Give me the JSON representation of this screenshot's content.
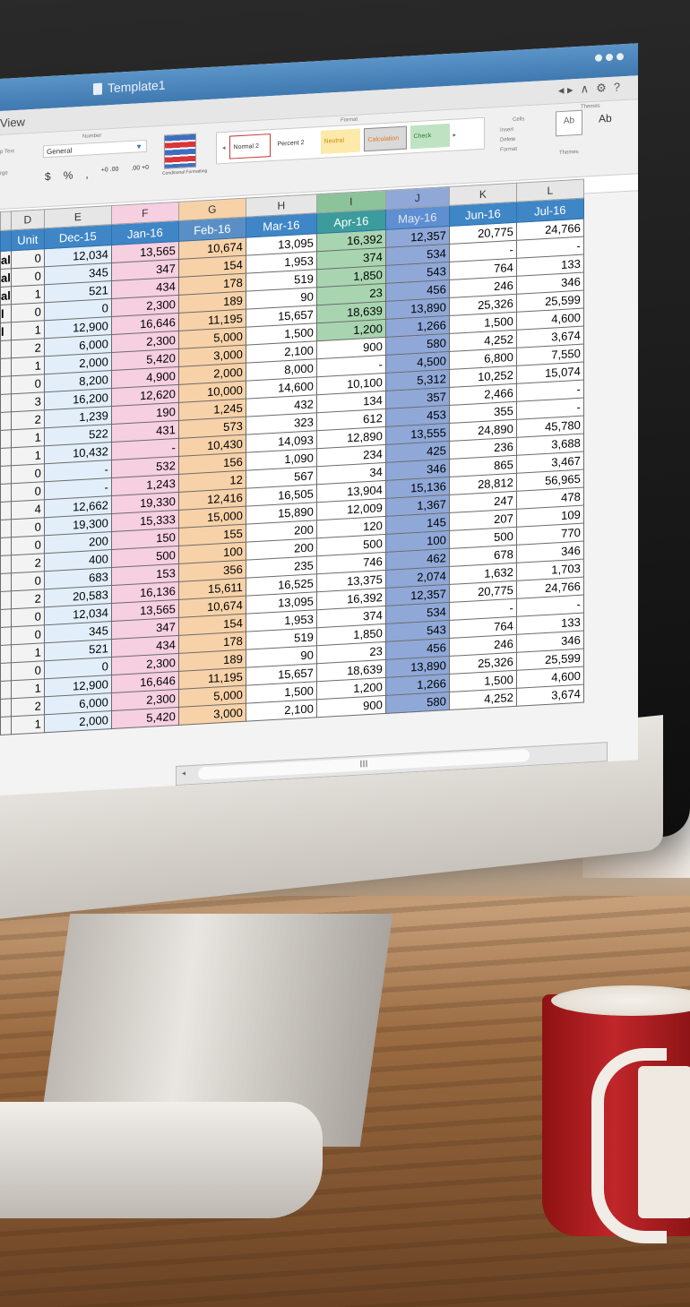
{
  "window": {
    "title": "Template1"
  },
  "menu": {
    "view_label": "View"
  },
  "ribbon": {
    "number_group_label": "Number",
    "format_group_label": "Format",
    "cells_group_label": "Cells",
    "themes_group_label": "Themes",
    "wrap_text_label": "p Text",
    "merge_label": "rge",
    "number_format_value": "General",
    "currency_label": "$",
    "percent_label": "%",
    "comma_label": ",",
    "conditional_formatting_label": "Conditional Formatting",
    "cell_styles": [
      "Normal 2",
      "Percent 2",
      "Neutral",
      "Calculation",
      "Check"
    ],
    "insert_label": "Insert",
    "delete_label": "Delete",
    "format_label": "Format",
    "themes_label": "Themes",
    "themes_icon_text": "Ab",
    "themes_font_text": "Ab"
  },
  "sheet": {
    "column_letters": [
      "D",
      "E",
      "F",
      "G",
      "H",
      "I",
      "J",
      "K",
      "L"
    ],
    "header_row": [
      "Unit",
      "Dec-15",
      "Jan-16",
      "Feb-16",
      "Mar-16",
      "Apr-16",
      "May-16",
      "Jun-16",
      "Jul-16"
    ],
    "rows": [
      [
        "0",
        "12,034",
        "13,565",
        "10,674",
        "13,095",
        "16,392",
        "12,357",
        "20,775",
        "24,766"
      ],
      [
        "0",
        "345",
        "347",
        "154",
        "1,953",
        "374",
        "534",
        "-",
        "-"
      ],
      [
        "1",
        "521",
        "434",
        "178",
        "519",
        "1,850",
        "543",
        "764",
        "133"
      ],
      [
        "0",
        "0",
        "2,300",
        "189",
        "90",
        "23",
        "456",
        "246",
        "346"
      ],
      [
        "1",
        "12,900",
        "16,646",
        "11,195",
        "15,657",
        "18,639",
        "13,890",
        "25,326",
        "25,599"
      ],
      [
        "2",
        "6,000",
        "2,300",
        "5,000",
        "1,500",
        "1,200",
        "1,266",
        "1,500",
        "4,600"
      ],
      [
        "1",
        "2,000",
        "5,420",
        "3,000",
        "2,100",
        "900",
        "580",
        "4,252",
        "3,674"
      ],
      [
        "0",
        "8,200",
        "4,900",
        "2,000",
        "8,000",
        "-",
        "4,500",
        "6,800",
        "7,550"
      ],
      [
        "3",
        "16,200",
        "12,620",
        "10,000",
        "14,600",
        "10,100",
        "5,312",
        "10,252",
        "15,074"
      ],
      [
        "2",
        "1,239",
        "190",
        "1,245",
        "432",
        "134",
        "357",
        "2,466",
        "-"
      ],
      [
        "1",
        "522",
        "431",
        "573",
        "323",
        "612",
        "453",
        "355",
        "-"
      ],
      [
        "1",
        "10,432",
        "-",
        "10,430",
        "14,093",
        "12,890",
        "13,555",
        "24,890",
        "45,780"
      ],
      [
        "0",
        "-",
        "532",
        "156",
        "1,090",
        "234",
        "425",
        "236",
        "3,688"
      ],
      [
        "0",
        "-",
        "1,243",
        "12",
        "567",
        "34",
        "346",
        "865",
        "3,467"
      ],
      [
        "4",
        "12,662",
        "19,330",
        "12,416",
        "16,505",
        "13,904",
        "15,136",
        "28,812",
        "56,965"
      ],
      [
        "0",
        "19,300",
        "15,333",
        "15,000",
        "15,890",
        "12,009",
        "1,367",
        "247",
        "478"
      ],
      [
        "0",
        "200",
        "150",
        "155",
        "200",
        "120",
        "145",
        "207",
        "109"
      ],
      [
        "2",
        "400",
        "500",
        "100",
        "200",
        "500",
        "100",
        "500",
        "770"
      ],
      [
        "0",
        "683",
        "153",
        "356",
        "235",
        "746",
        "462",
        "678",
        "346"
      ],
      [
        "2",
        "20,583",
        "16,136",
        "15,611",
        "16,525",
        "13,375",
        "2,074",
        "1,632",
        "1,703"
      ],
      [
        "0",
        "12,034",
        "13,565",
        "10,674",
        "13,095",
        "16,392",
        "12,357",
        "20,775",
        "24,766"
      ],
      [
        "0",
        "345",
        "347",
        "154",
        "1,953",
        "374",
        "534",
        "-",
        "-"
      ],
      [
        "1",
        "521",
        "434",
        "178",
        "519",
        "1,850",
        "543",
        "764",
        "133"
      ],
      [
        "0",
        "0",
        "2,300",
        "189",
        "90",
        "23",
        "456",
        "246",
        "346"
      ],
      [
        "1",
        "12,900",
        "16,646",
        "11,195",
        "15,657",
        "18,639",
        "13,890",
        "25,326",
        "25,599"
      ],
      [
        "2",
        "6,000",
        "2,300",
        "5,000",
        "1,500",
        "1,200",
        "1,266",
        "1,500",
        "4,600"
      ],
      [
        "1",
        "2,000",
        "5,420",
        "3,000",
        "2,100",
        "900",
        "580",
        "4,252",
        "3,674"
      ]
    ],
    "stub_labels": [
      "al",
      "al",
      "al",
      "l",
      "l",
      "",
      "",
      "",
      "",
      "",
      "",
      "",
      "",
      "",
      "",
      "",
      "",
      "",
      "",
      "",
      "",
      "",
      "",
      "",
      "",
      "",
      ""
    ],
    "scroll_thumb_text": "III"
  },
  "colors": {
    "header_blue": "#3f86c6",
    "col_e_fill": "#e2effb",
    "col_f_fill": "#f6cfe1",
    "col_g_fill": "#f7d2a8",
    "col_i_fill": "#a8d5b0",
    "col_j_fill": "#8fa8d8",
    "titlebar": "#4a86bd"
  }
}
